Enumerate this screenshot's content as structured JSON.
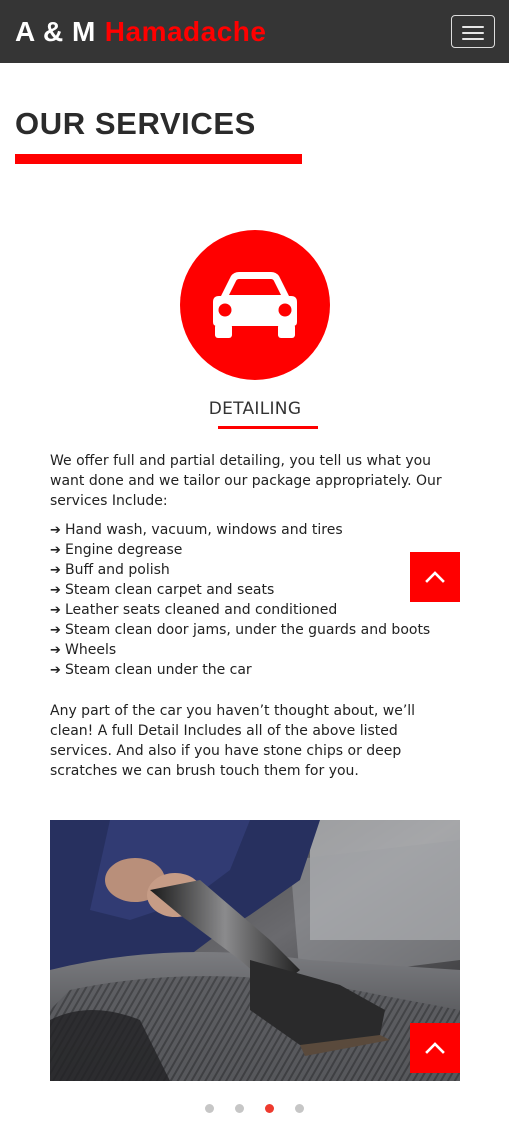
{
  "header": {
    "brand_part1": "A & M",
    "brand_part2": "Hamadache",
    "menu_icon": "hamburger-menu-icon"
  },
  "section": {
    "title": "OUR SERVICES"
  },
  "service": {
    "icon": "car-icon",
    "heading": "DETAILING",
    "intro": "We offer full and partial detailing, you tell us what you want done and we tailor our package appropriately. Our services Include:",
    "items": [
      "Hand wash, vacuum, windows and tires",
      "Engine degrease",
      "Buff and polish",
      "Steam clean carpet and seats",
      "Leather seats cleaned and conditioned",
      "Steam clean door jams, under the guards and boots",
      "Wheels",
      "Steam clean under the car"
    ],
    "item_icon": "arrow-right-icon",
    "outro": "Any part of the car you haven’t thought about, we’ll clean! A full Detail Includes all of the above listed services. And also if you have stone chips or deep scratches we can brush touch them for you."
  },
  "photo": {
    "subject": "person vacuuming car seat"
  },
  "carousel": {
    "total": 4,
    "active_index": 2
  },
  "back_to_top": {
    "icon": "chevron-up-icon"
  },
  "colors": {
    "accent": "#ff0000",
    "navbar": "#353535",
    "dot_inactive": "#c6c6c6",
    "dot_active": "#ee3a2e"
  }
}
